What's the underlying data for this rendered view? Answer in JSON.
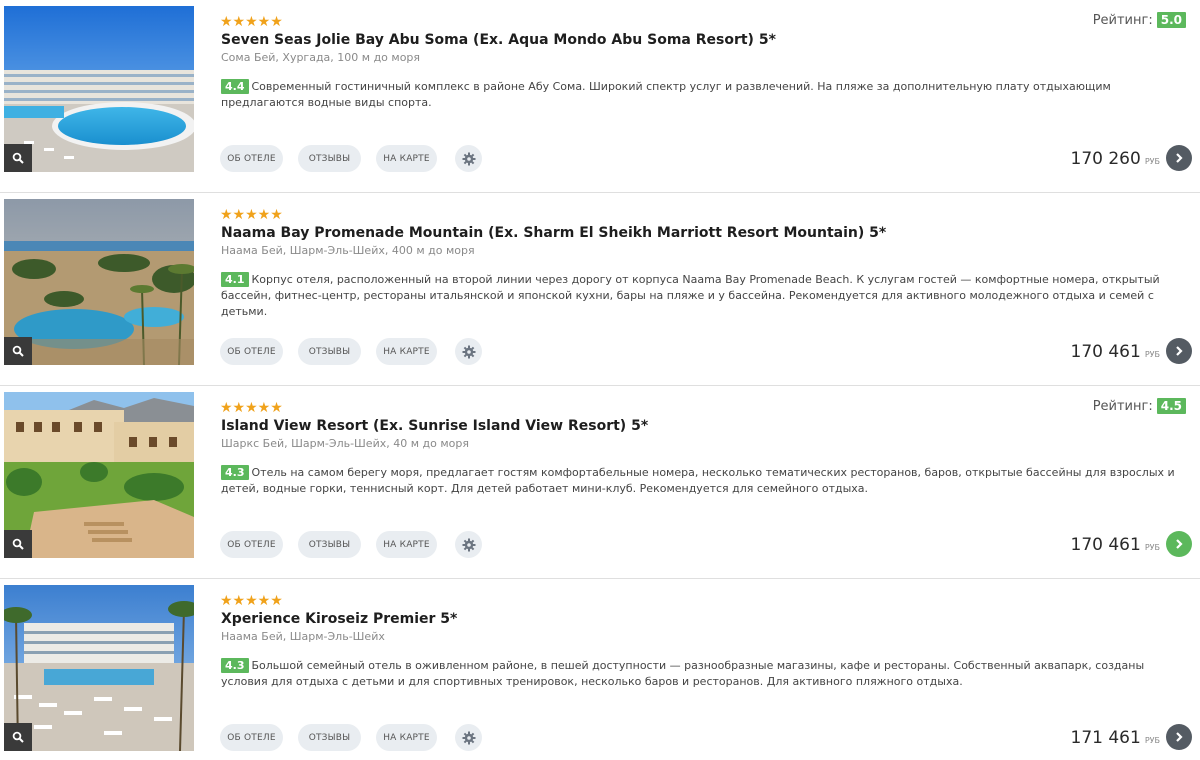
{
  "currency": "РУБ",
  "rating_label": "Рейтинг:",
  "buttons": {
    "about": "ОБ ОТЕЛЕ",
    "reviews": "ОТЗЫВЫ",
    "map": "НА КАРТЕ"
  },
  "hotels": [
    {
      "stars": "★★★★★",
      "name": "Seven Seas Jolie Bay Abu Soma (Ex. Aqua Mondo Abu Soma Resort) 5*",
      "location": "Сома Бей, Хургада, 100 м до моря",
      "score": "4.4",
      "description": "Современный гостиничный комплекс в районе Абу Сома. Широкий спектр услуг и развлечений. На пляже за дополнительную плату отдыхающим предлагаются водные виды спорта.",
      "rating": "5.0",
      "price": "170 260"
    },
    {
      "stars": "★★★★★",
      "name": "Naama Bay Promenade Mountain (Ex. Sharm El Sheikh Marriott Resort Mountain) 5*",
      "location": "Наама Бей, Шарм-Эль-Шейх, 400 м до моря",
      "score": "4.1",
      "description": "Корпус отеля, расположенный на второй линии через дорогу от корпуса Naama Bay Promenade Beach. К услугам гостей — комфортные номера, открытый бассейн, фитнес-центр, рестораны итальянской и японской кухни, бары на пляже и у бассейна. Рекомендуется для активного молодежного отдыха и семей с детьми.",
      "price": "170 461"
    },
    {
      "stars": "★★★★★",
      "name": "Island View Resort (Ex. Sunrise Island View Resort) 5*",
      "location": "Шаркс Бей, Шарм-Эль-Шейх, 40 м до моря",
      "score": "4.3",
      "description": "Отель на самом берегу моря, предлагает гостям комфортабельные номера, несколько тематических ресторанов, баров, открытые бассейны для взрослых и детей, водные горки, теннисный корт. Для детей работает мини-клуб. Рекомендуется для семейного отдыха.",
      "rating": "4.5",
      "price": "170 461"
    },
    {
      "stars": "★★★★★",
      "name": "Xperience Kiroseiz Premier 5*",
      "location": "Наама Бей, Шарм-Эль-Шейх",
      "score": "4.3",
      "description": "Большой семейный отель в оживленном районе, в пешей доступности — разнообразные магазины, кафе и рестораны. Собственный аквапарк, созданы условия для отдыха с детьми и для спортивных тренировок, несколько баров и ресторанов. Для активного пляжного отдыха.",
      "price": "171 461"
    }
  ],
  "colors": {
    "score_green": "#5cb85c",
    "star_orange": "#f0a21b",
    "button_bg": "#e9edf1",
    "arrow_dark": "#545b63"
  },
  "icons": {
    "zoom": "magnifier-icon",
    "settings": "gear-icon",
    "next": "chevron-right-icon"
  }
}
